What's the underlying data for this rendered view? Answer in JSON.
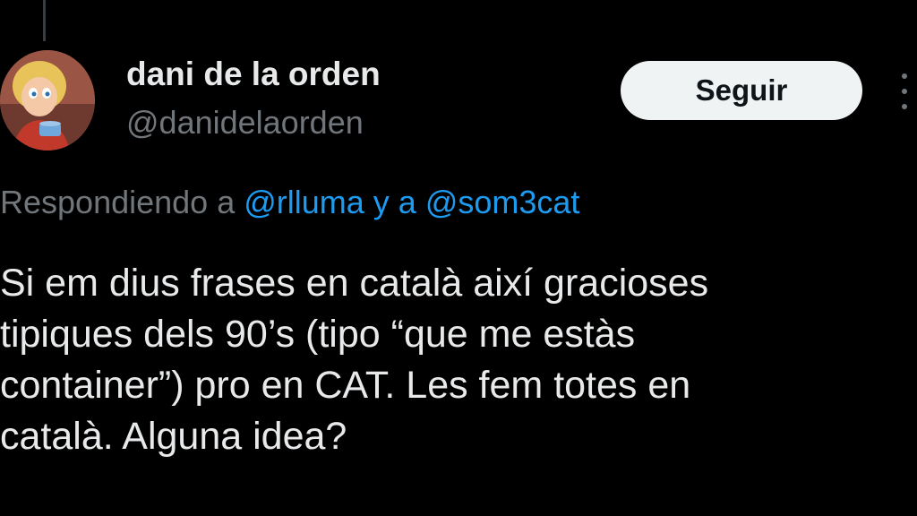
{
  "author": {
    "display_name": "dani de la orden",
    "handle": "@danidelaorden"
  },
  "follow_button": {
    "label": "Seguir"
  },
  "reply_context": {
    "prefix": "Respondiendo a ",
    "mention_1": "@rlluma",
    "conjunction": " y a ",
    "mention_2": "@som3cat"
  },
  "tweet": {
    "text": "Si em dius frases en català així gracioses\ntipiques dels 90’s (tipo “que me estàs\ncontainer”) pro en CAT. Les fem totes en\ncatalà. Alguna idea?"
  },
  "icons": {
    "more": "more-options-icon",
    "avatar": "avatar-cartoon"
  },
  "colors": {
    "background": "#000000",
    "text_primary": "#e7e9ea",
    "text_secondary": "#71767b",
    "link": "#1d9bf0",
    "button_bg": "#eff3f4",
    "button_text": "#0f1419"
  }
}
